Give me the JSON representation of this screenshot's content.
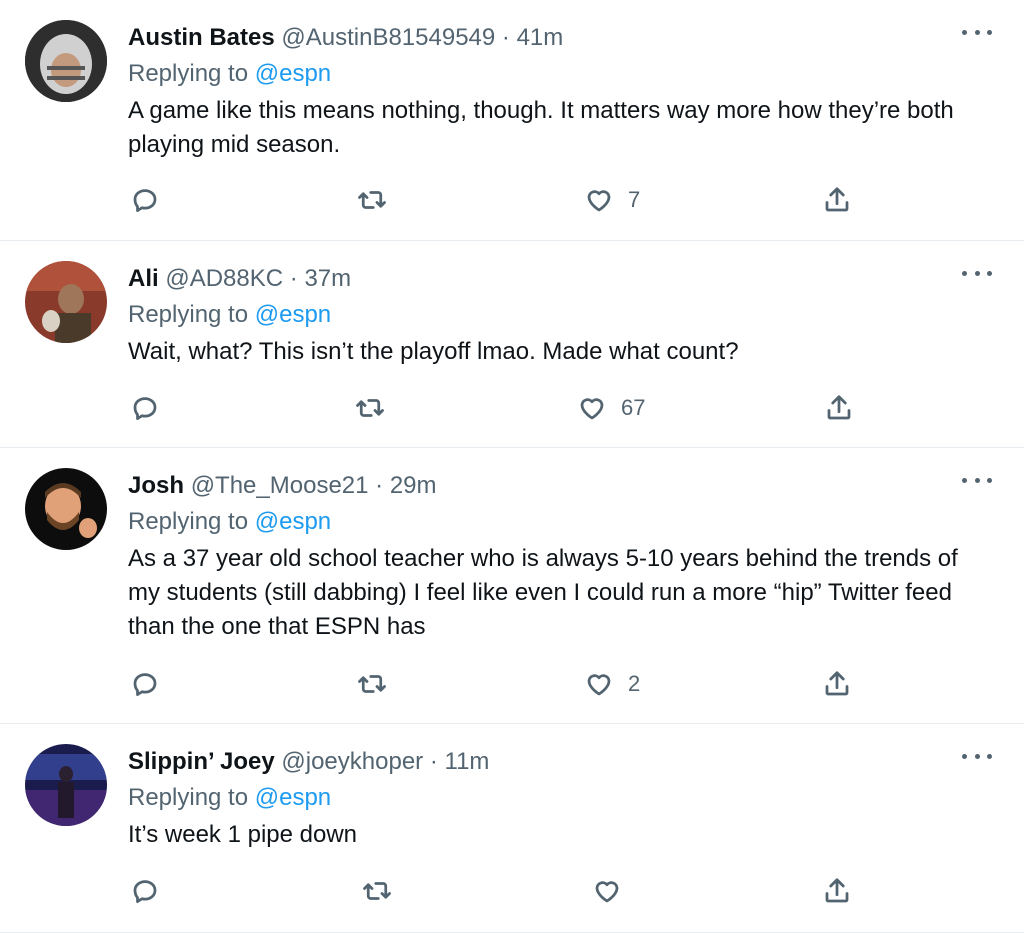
{
  "tweets": [
    {
      "name": "Austin Bates",
      "handle": "@AustinB81549549",
      "dot": "·",
      "time": "41m",
      "reply_prefix": "Replying to",
      "reply_to": "@espn",
      "text": "A game like this means nothing, though. It matters way more how they’re both playing mid season.",
      "likes": "7",
      "avatar_color": "#3a3a3a"
    },
    {
      "name": "Ali",
      "handle": "@AD88KC",
      "dot": "·",
      "time": "37m",
      "reply_prefix": "Replying to",
      "reply_to": "@espn",
      "text": "Wait, what? This isn’t the playoff lmao. Made what count?",
      "likes": "67",
      "avatar_color": "#7a3b2e"
    },
    {
      "name": "Josh",
      "handle": "@The_Moose21",
      "dot": "·",
      "time": "29m",
      "reply_prefix": "Replying to",
      "reply_to": "@espn",
      "text": "As a 37 year old school teacher who is always 5-10 years behind the trends of my students (still dabbing) I feel like even I could run a more “hip” Twitter feed than the one that ESPN has",
      "likes": "2",
      "avatar_color": "#111111"
    },
    {
      "name": "Slippin’ Joey",
      "handle": "@joeykhoper",
      "dot": "·",
      "time": "11m",
      "reply_prefix": "Replying to",
      "reply_to": "@espn",
      "text": "It’s week 1 pipe down",
      "likes": "",
      "avatar_color": "#1c1f5a"
    }
  ],
  "colors": {
    "link": "#1d9bf0",
    "secondary": "#536471",
    "divider": "#e6ecf0"
  },
  "icons": [
    "reply-icon",
    "retweet-icon",
    "like-icon",
    "share-icon",
    "more-icon"
  ]
}
